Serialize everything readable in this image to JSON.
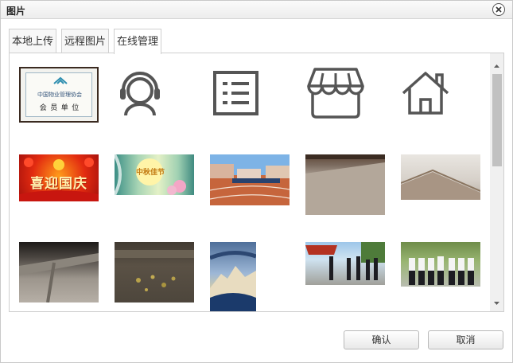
{
  "dialog": {
    "title": "图片"
  },
  "tabs": [
    {
      "label": "本地上传",
      "active": false
    },
    {
      "label": "远程图片",
      "active": false
    },
    {
      "label": "在线管理",
      "active": true
    }
  ],
  "gallery": {
    "plaque_text": {
      "line1": "中国物业管理协会",
      "line2": "会 员 单 位"
    },
    "banner_text": "喜迎国庆",
    "moon_text": "中秋佳节"
  },
  "buttons": {
    "confirm": "确认",
    "cancel": "取消"
  },
  "colors": {
    "icon_stroke": "#555555",
    "tab_border": "#cfcfcf",
    "scroll_thumb": "#c1c1c1"
  }
}
